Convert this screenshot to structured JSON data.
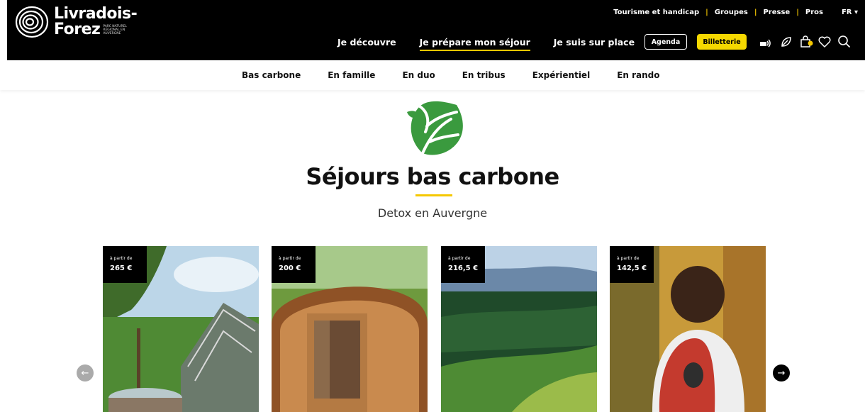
{
  "header": {
    "logo": {
      "line1": "Livradois-",
      "line2": "Forez",
      "subtitle": "PARC NATUREL RÉGIONAL EN AUVERGNE"
    },
    "top_links": [
      "Tourisme et handicap",
      "Groupes",
      "Presse",
      "Pros"
    ],
    "language": "FR",
    "main_nav": [
      {
        "label": "Je découvre",
        "active": false
      },
      {
        "label": "Je prépare mon séjour",
        "active": true
      },
      {
        "label": "Je suis sur place",
        "active": false
      }
    ],
    "agenda_label": "Agenda",
    "billetterie_label": "Billetterie",
    "accent_color": "#f5c800"
  },
  "subnav": [
    "Bas carbone",
    "En famille",
    "En duo",
    "En tribus",
    "Expérientiel",
    "En rando"
  ],
  "page": {
    "title": "Séjours bas carbone",
    "subtitle": "Detox en Auvergne"
  },
  "cards": [
    {
      "price_label": "à partir de",
      "price": "265 €",
      "scene": "dome-hot-tub"
    },
    {
      "price_label": "à partir de",
      "price": "200 €",
      "scene": "barrel-sauna"
    },
    {
      "price_label": "à partir de",
      "price": "216,5 €",
      "scene": "forest-mountains"
    },
    {
      "price_label": "à partir de",
      "price": "142,5 €",
      "scene": "hiker-backpack"
    }
  ],
  "icons": [
    "logo-rings-icon",
    "leaf-icon",
    "bag-icon",
    "heart-icon",
    "search-icon",
    "arrow-left-icon",
    "arrow-right-icon"
  ]
}
